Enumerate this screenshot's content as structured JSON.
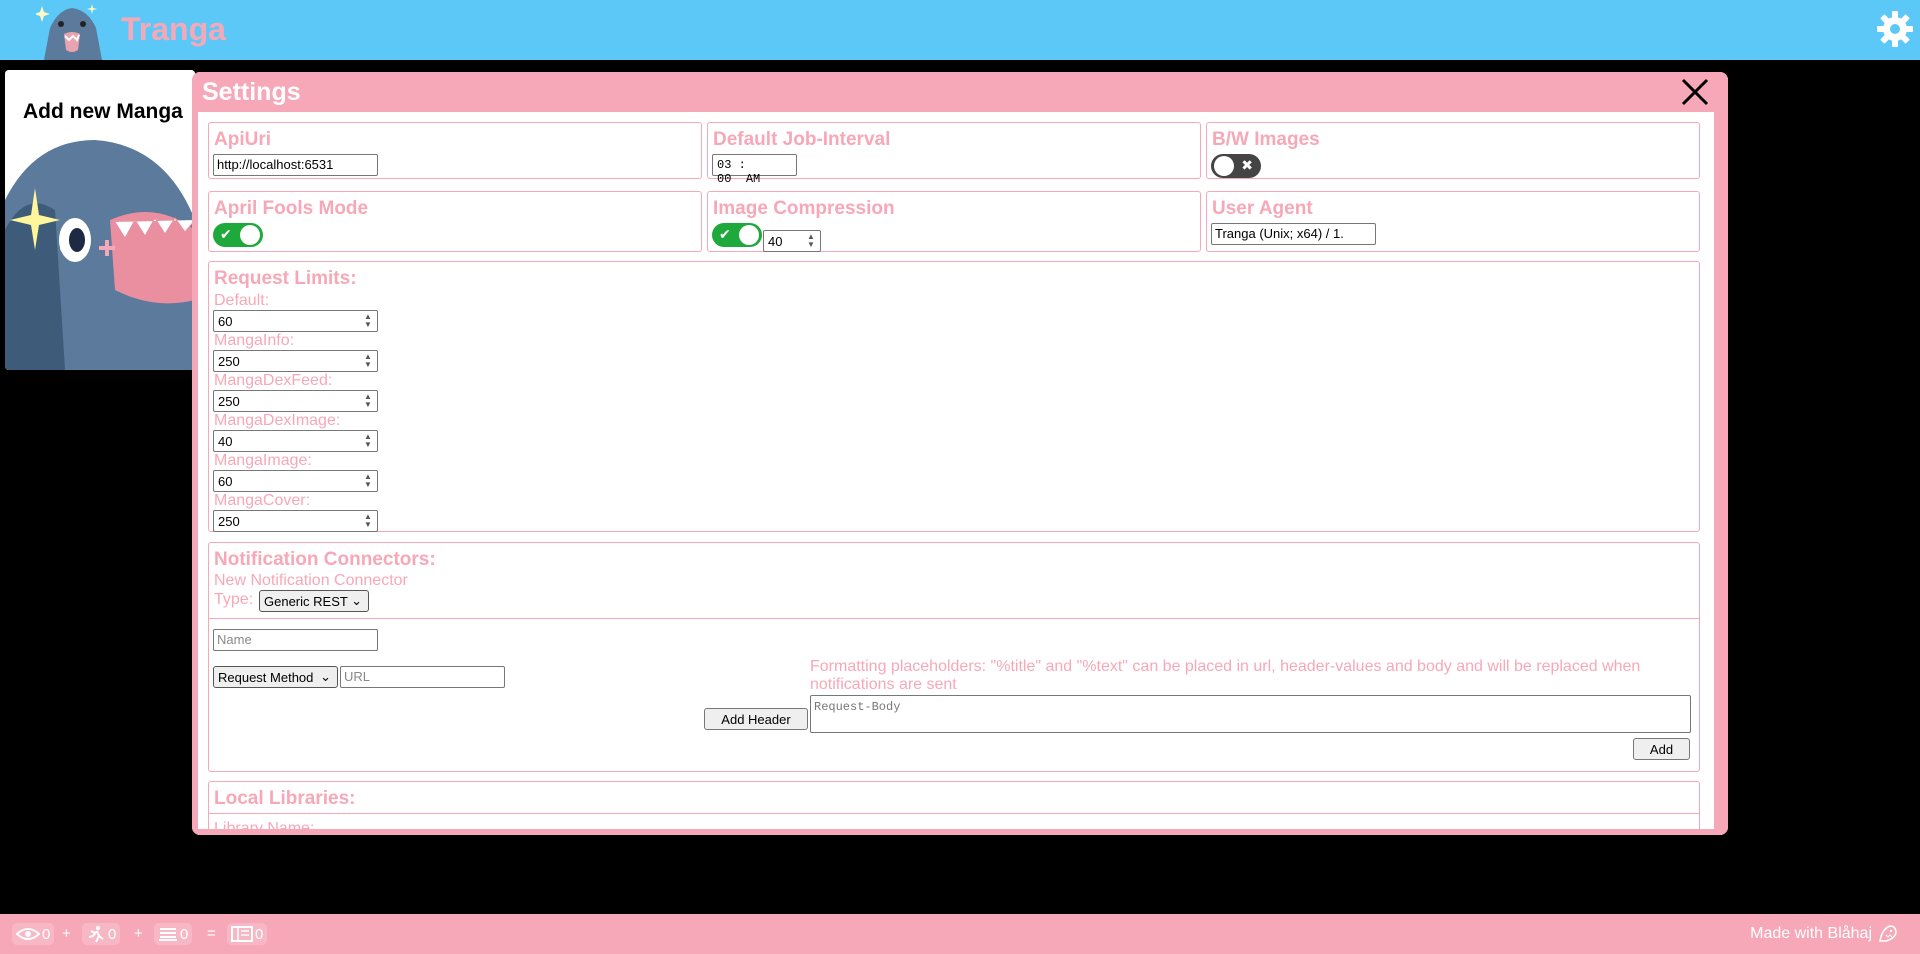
{
  "app": {
    "title": "Tranga"
  },
  "tile": {
    "title": "Add new Manga"
  },
  "settings": {
    "title": "Settings",
    "apiuri": {
      "label": "ApiUri",
      "value": "http://localhost:6531"
    },
    "job_interval": {
      "label": "Default Job-Interval",
      "hours": "03",
      "minutes": "00",
      "ampm": "AM"
    },
    "bw_images": {
      "label": "B/W Images",
      "enabled": false
    },
    "april_fools": {
      "label": "April Fools Mode",
      "enabled": true
    },
    "image_compression": {
      "label": "Image Compression",
      "enabled": true,
      "value": "40"
    },
    "user_agent": {
      "label": "User Agent",
      "value": "Tranga (Unix; x64) / 1."
    },
    "request_limits": {
      "label": "Request Limits:",
      "items": [
        {
          "label": "Default:",
          "value": "60"
        },
        {
          "label": "MangaInfo:",
          "value": "250"
        },
        {
          "label": "MangaDexFeed:",
          "value": "250"
        },
        {
          "label": "MangaDexImage:",
          "value": "40"
        },
        {
          "label": "MangaImage:",
          "value": "60"
        },
        {
          "label": "MangaCover:",
          "value": "250"
        }
      ]
    },
    "notifications": {
      "label": "Notification Connectors:",
      "new_label": "New Notification Connector",
      "type_label": "Type:",
      "type_value": "Generic REST",
      "name_placeholder": "Name",
      "method_value": "Request Method",
      "url_placeholder": "URL",
      "hint": "Formatting placeholders: \"%title\" and \"%text\" can be placed in url, header-values and body and will be replaced when notifications are sent",
      "add_header_label": "Add Header",
      "body_placeholder": "Request-Body",
      "add_label": "Add"
    },
    "local_libraries": {
      "label": "Local Libraries:",
      "name_label": "Library Name:"
    }
  },
  "footer": {
    "monitoring": "0",
    "running": "0",
    "waiting": "0",
    "total": "0",
    "plus1": "+",
    "plus2": "+",
    "equals": "=",
    "made_with": "Made with Blåhaj"
  },
  "colors": {
    "topbar": "#5cc8f7",
    "accent": "#f7a8b8",
    "toggle_on": "#1fa83b",
    "toggle_off": "#444444"
  }
}
